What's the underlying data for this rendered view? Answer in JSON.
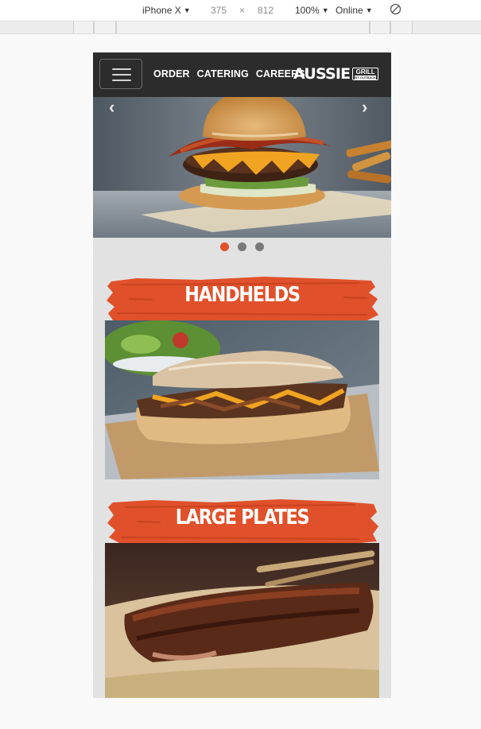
{
  "devtools": {
    "device": "iPhone X",
    "width": "375",
    "times": "×",
    "height": "812",
    "zoom": "100%",
    "network": "Online"
  },
  "site": {
    "nav": [
      "ORDER",
      "CATERING",
      "CAREERS"
    ],
    "logo": {
      "word": "AUSSIE",
      "badge": "GRILL",
      "badge_sub": "BY OUTBACK"
    }
  },
  "hero": {
    "prev_glyph": "‹",
    "next_glyph": "›",
    "slides": 3,
    "active_slide": 1
  },
  "categories": [
    {
      "title": "HANDHELDS"
    },
    {
      "title": "LARGE PLATES"
    }
  ],
  "colors": {
    "brand_orange": "#e0512b",
    "header_bg": "#2c2c2c"
  }
}
